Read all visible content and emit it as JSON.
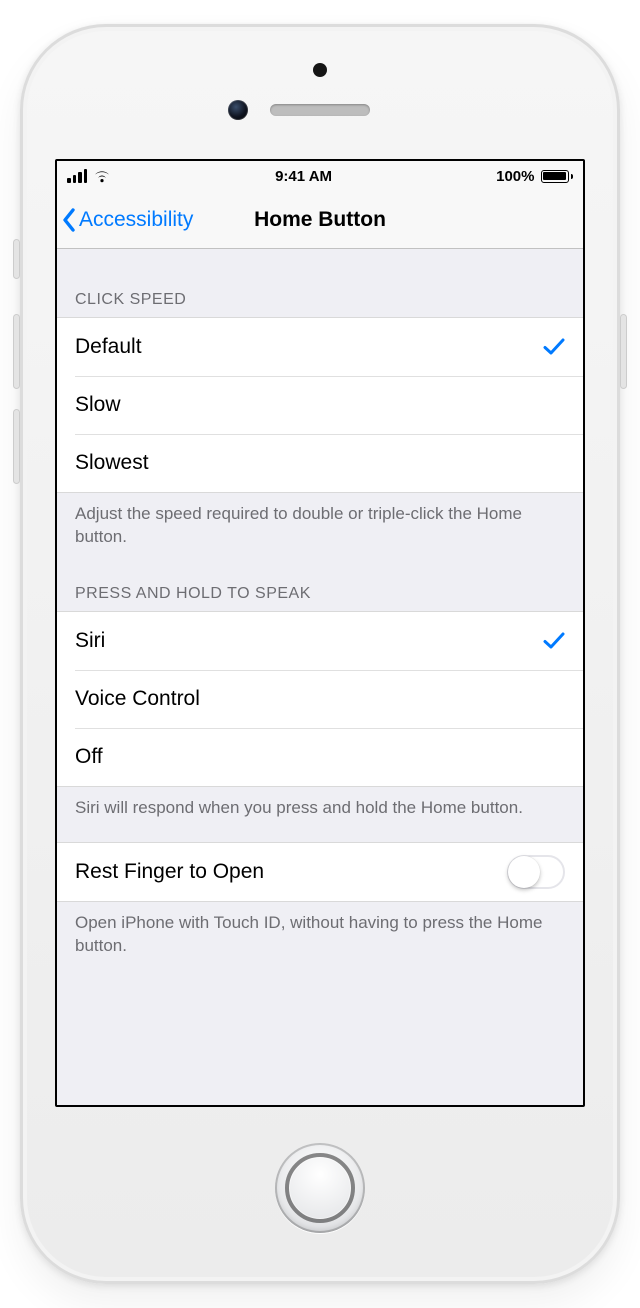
{
  "status": {
    "time": "9:41 AM",
    "battery_pct": "100%"
  },
  "nav": {
    "back_label": "Accessibility",
    "title": "Home Button"
  },
  "click_speed": {
    "header": "CLICK SPEED",
    "options": {
      "default": "Default",
      "slow": "Slow",
      "slowest": "Slowest"
    },
    "selected": "default",
    "footer": "Adjust the speed required to double or triple-click the Home button."
  },
  "press_hold": {
    "header": "PRESS AND HOLD TO SPEAK",
    "options": {
      "siri": "Siri",
      "voice_control": "Voice Control",
      "off": "Off"
    },
    "selected": "siri",
    "footer": "Siri will respond when you press and hold the Home button."
  },
  "rest_finger": {
    "label": "Rest Finger to Open",
    "value": false,
    "footer": "Open iPhone with Touch ID, without having to press the Home button."
  }
}
